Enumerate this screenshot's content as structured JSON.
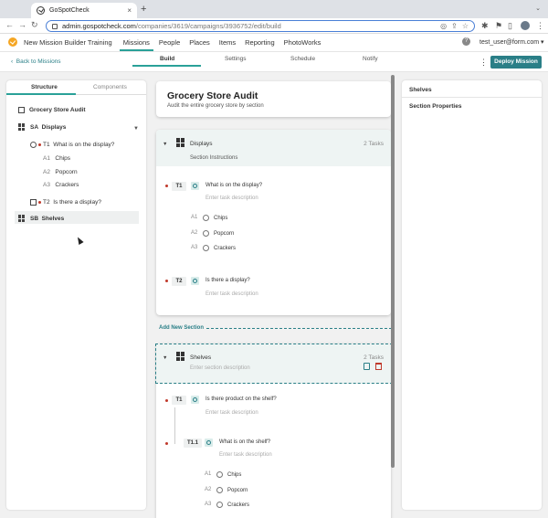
{
  "browser": {
    "tab_title": "GoSpotCheck",
    "tab_close": "×",
    "new_tab": "+",
    "url_host": "admin.gospotcheck.com",
    "url_path": "/companies/3619/campaigns/3936752/edit/build"
  },
  "app": {
    "title": "New Mission Builder Training",
    "menu": [
      "Missions",
      "People",
      "Places",
      "Items",
      "Reporting",
      "PhotoWorks"
    ],
    "active_menu": "Missions",
    "help": "?",
    "user": "test_user@form.com ▾"
  },
  "subheader": {
    "back": "Back to Missions",
    "steps": [
      "Build",
      "Settings",
      "Schedule",
      "Notify"
    ],
    "active_step": "Build",
    "deploy": "Deploy Mission"
  },
  "left_panel": {
    "tabs": [
      "Structure",
      "Components"
    ],
    "active_tab": "Structure",
    "tree": {
      "mission": "Grocery Store Audit",
      "sections": [
        {
          "code": "SA",
          "name": "Displays",
          "tasks": [
            {
              "code": "T1",
              "label": "What is on the display?",
              "options": [
                {
                  "code": "A1",
                  "label": "Chips"
                },
                {
                  "code": "A2",
                  "label": "Popcorn"
                },
                {
                  "code": "A3",
                  "label": "Crackers"
                }
              ]
            },
            {
              "code": "T2",
              "label": "Is there a display?"
            }
          ]
        },
        {
          "code": "SB",
          "name": "Shelves"
        }
      ]
    }
  },
  "mission_card": {
    "title": "Grocery Store Audit",
    "description": "Audit the entire grocery store by section"
  },
  "sections": [
    {
      "name": "Displays",
      "tasks_count": "2 Tasks",
      "instructions": "Section Instructions",
      "tasks": [
        {
          "code": "T1",
          "label": "What is on the display?",
          "desc_placeholder": "Enter task description",
          "options": [
            {
              "code": "A1",
              "label": "Chips"
            },
            {
              "code": "A2",
              "label": "Popcorn"
            },
            {
              "code": "A3",
              "label": "Crackers"
            }
          ]
        },
        {
          "code": "T2",
          "label": "Is there a display?",
          "desc_placeholder": "Enter task description"
        }
      ]
    },
    {
      "name": "Shelves",
      "tasks_count": "2 Tasks",
      "desc_placeholder": "Enter section description",
      "tasks": [
        {
          "code": "T1",
          "label": "Is there product on the shelf?",
          "desc_placeholder": "Enter task description"
        },
        {
          "code": "T1.1",
          "label": "What is on the shelf?",
          "desc_placeholder": "Enter task description",
          "options": [
            {
              "code": "A1",
              "label": "Chips"
            },
            {
              "code": "A2",
              "label": "Popcorn"
            },
            {
              "code": "A3",
              "label": "Crackers"
            }
          ]
        }
      ]
    }
  ],
  "add_section": "Add New Section",
  "right_panel": {
    "title": "Shelves",
    "subtitle": "Section Properties"
  },
  "colors": {
    "accent": "#2a7f87",
    "highlight": "#2aa198",
    "required_dot": "#c0392b",
    "logo": "#f5a623"
  }
}
